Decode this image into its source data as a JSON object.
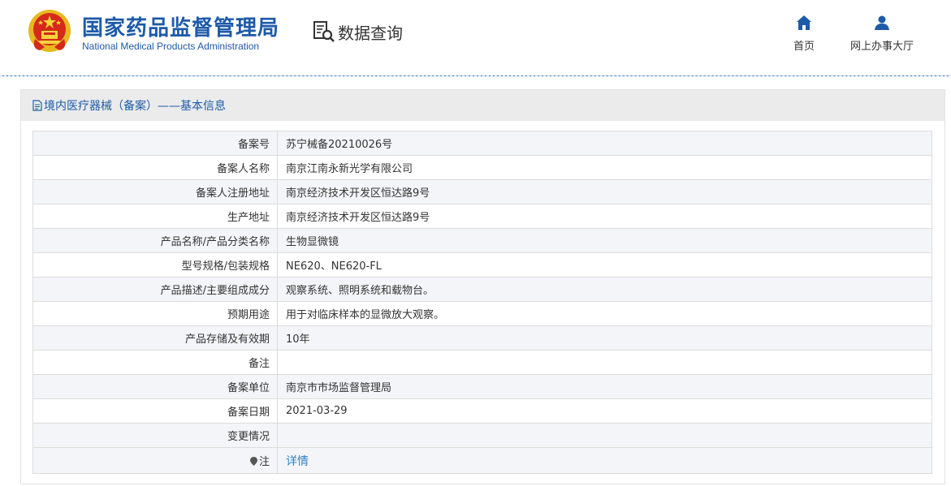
{
  "header": {
    "org_name_cn": "国家药品监督管理局",
    "org_name_en": "National Medical Products Administration",
    "data_query_label": "数据查询",
    "nav": {
      "home_label": "首页",
      "online_hall_label": "网上办事大厅"
    },
    "brand_color": "#1d5aa8"
  },
  "panel": {
    "title": "境内医疗器械（备案）——基本信息"
  },
  "record": {
    "rows": [
      {
        "label": "备案号",
        "value": "苏宁械备20210026号"
      },
      {
        "label": "备案人名称",
        "value": "南京江南永新光学有限公司"
      },
      {
        "label": "备案人注册地址",
        "value": "南京经济技术开发区恒达路9号"
      },
      {
        "label": "生产地址",
        "value": "南京经济技术开发区恒达路9号"
      },
      {
        "label": "产品名称/产品分类名称",
        "value": "生物显微镜"
      },
      {
        "label": "型号规格/包装规格",
        "value": "NE620、NE620-FL"
      },
      {
        "label": "产品描述/主要组成成分",
        "value": "观察系统、照明系统和载物台。"
      },
      {
        "label": "预期用途",
        "value": "用于对临床样本的显微放大观察。"
      },
      {
        "label": "产品存储及有效期",
        "value": "10年"
      },
      {
        "label": "备注",
        "value": ""
      },
      {
        "label": "备案单位",
        "value": "南京市市场监督管理局"
      },
      {
        "label": "备案日期",
        "value": "2021-03-29"
      },
      {
        "label": "变更情况",
        "value": ""
      }
    ],
    "note_label": "注",
    "detail_link": "详情"
  }
}
